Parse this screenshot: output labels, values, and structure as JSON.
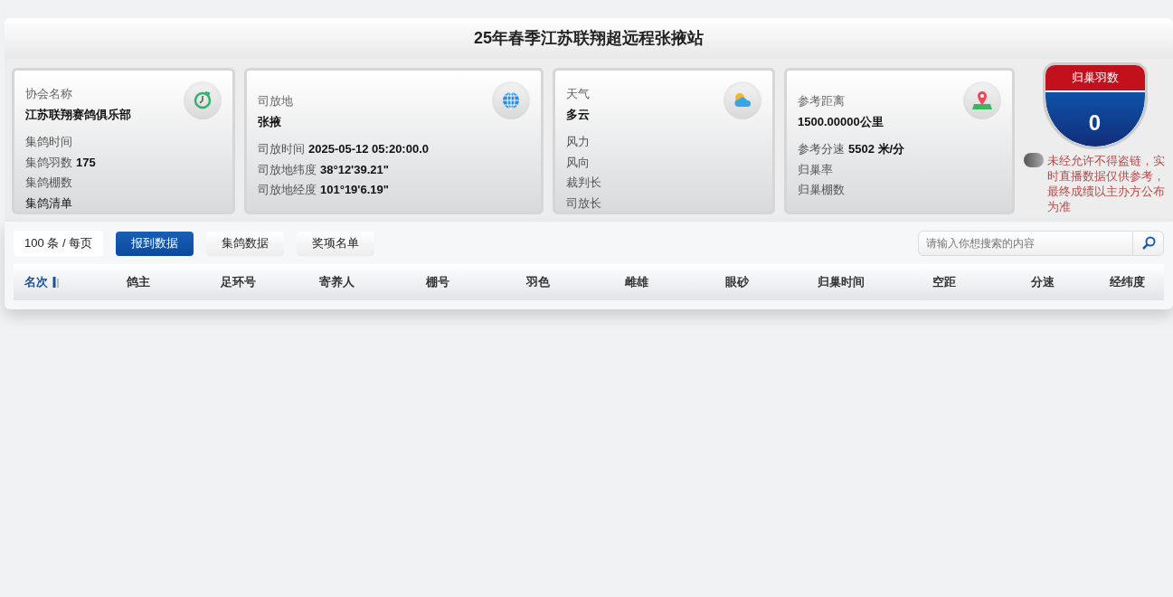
{
  "title": "25年春季江苏联翔超远程张掖站",
  "cards": [
    {
      "kind": "clock",
      "heading": {
        "label": "协会名称",
        "value": "江苏联翔赛鸽俱乐部"
      },
      "rows": [
        {
          "kind": "field",
          "label": "集鸽时间"
        },
        {
          "kind": "field",
          "label": "集鸽羽数",
          "value": "175"
        },
        {
          "kind": "field",
          "label": "集鸽棚数"
        },
        {
          "kind": "link",
          "label": "集鸽清单"
        }
      ]
    },
    {
      "kind": "globe",
      "heading": {
        "label": "司放地",
        "value": "张掖"
      },
      "rows": [
        {
          "kind": "field",
          "label": "司放时间",
          "value": "2025-05-12 05:20:00.0"
        },
        {
          "kind": "field",
          "label": "司放地纬度",
          "value": "38°12'39.21\""
        },
        {
          "kind": "field",
          "label": "司放地经度",
          "value": "101°19'6.19\""
        }
      ]
    },
    {
      "kind": "weather",
      "heading": {
        "label": "天气",
        "value": "多云"
      },
      "rows": [
        {
          "kind": "field",
          "label": "风力"
        },
        {
          "kind": "field",
          "label": "风向"
        },
        {
          "kind": "field",
          "label": "裁判长"
        },
        {
          "kind": "field",
          "label": "司放长"
        }
      ]
    },
    {
      "kind": "pin",
      "heading": {
        "label": "参考距离",
        "value": "1500.00000公里"
      },
      "rows": [
        {
          "kind": "field",
          "label": "参考分速",
          "value": "5502 米/分"
        },
        {
          "kind": "field",
          "label": "归巢率"
        },
        {
          "kind": "field",
          "label": "归巢棚数"
        }
      ]
    }
  ],
  "returned": {
    "label": "归巢羽数",
    "value": "0"
  },
  "notice": "未经允许不得盗链，实时直播数据仅供参考，最终成绩以主办方公布为准",
  "page_size": "100 条 / 每页",
  "tabs": [
    {
      "label": "报到数据",
      "selected": true
    },
    {
      "label": "集鸽数据",
      "selected": false
    },
    {
      "label": "奖项名单",
      "selected": false
    }
  ],
  "search": {
    "placeholder": "请输入你想搜索的内容"
  },
  "table": {
    "columns": [
      {
        "label": "名次",
        "sorted": true
      },
      {
        "label": "鸽主",
        "sorted": false
      },
      {
        "label": "足环号",
        "sorted": false
      },
      {
        "label": "寄养人",
        "sorted": false
      },
      {
        "label": "棚号",
        "sorted": false
      },
      {
        "label": "羽色",
        "sorted": false
      },
      {
        "label": "雌雄",
        "sorted": false
      },
      {
        "label": "眼砂",
        "sorted": false
      },
      {
        "label": "归巢时间",
        "sorted": false
      },
      {
        "label": "空距",
        "sorted": false
      },
      {
        "label": "分速",
        "sorted": false
      },
      {
        "label": "经纬度",
        "sorted": false
      }
    ]
  }
}
